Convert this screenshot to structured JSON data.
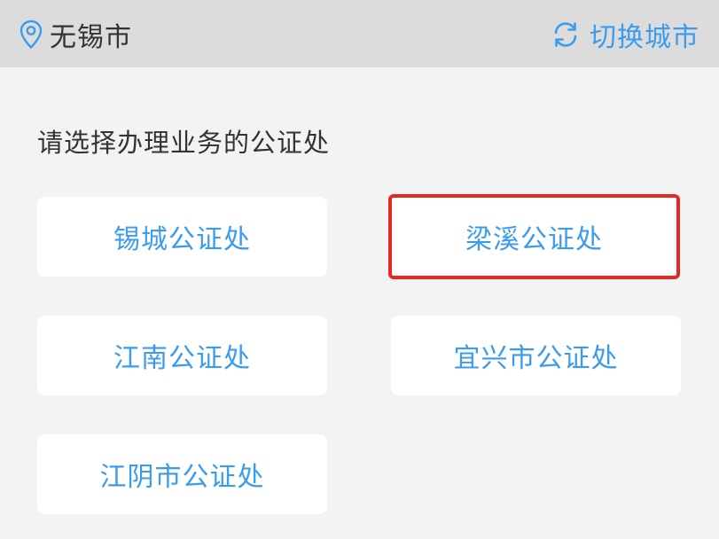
{
  "header": {
    "city_icon": "location-pin-icon",
    "city_name": "无锡市",
    "switch_icon": "refresh-icon",
    "switch_label": "切换城市"
  },
  "prompt": "请选择办理业务的公证处",
  "offices": [
    {
      "label": "锡城公证处",
      "selected": false
    },
    {
      "label": "梁溪公证处",
      "selected": true
    },
    {
      "label": "江南公证处",
      "selected": false
    },
    {
      "label": "宜兴市公证处",
      "selected": false
    },
    {
      "label": "江阴市公证处",
      "selected": false
    }
  ],
  "colors": {
    "accent": "#3a9bef",
    "header_bg": "#dcdcdc",
    "page_bg": "#f2f3f5",
    "highlight": "#e8281f"
  }
}
